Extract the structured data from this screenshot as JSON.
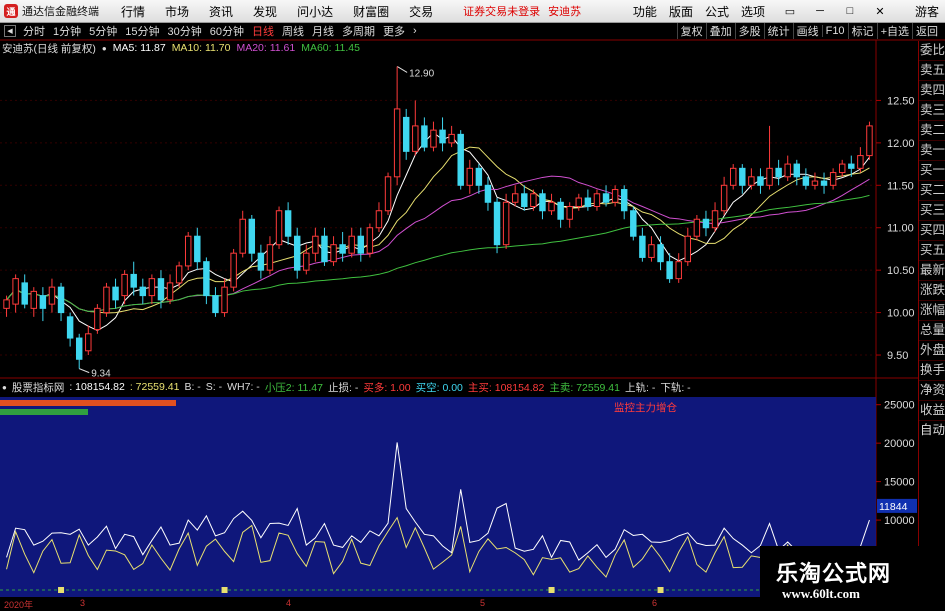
{
  "menubar": {
    "app_name": "通达信金融终端",
    "items": [
      "行情",
      "市场",
      "资讯",
      "发现",
      "问小达",
      "财富圈",
      "交易"
    ],
    "alert": "证券交易未登录",
    "stock": "安迪苏",
    "right_items": [
      "功能",
      "版面",
      "公式",
      "选项"
    ],
    "guest": "游客"
  },
  "toolbar": {
    "periods": [
      "分时",
      "1分钟",
      "5分钟",
      "15分钟",
      "30分钟",
      "60分钟",
      "日线",
      "周线",
      "月线",
      "多周期",
      "更多"
    ],
    "active_period": "日线",
    "right_items": [
      "复权",
      "叠加",
      "多股",
      "统计",
      "画线",
      "F10",
      "标记",
      "+自选",
      "返回"
    ]
  },
  "infobar": {
    "title": "安迪苏(日线 前复权)",
    "ma5": "MA5: 11.87",
    "ma10": "MA10: 11.70",
    "ma20": "MA20: 11.61",
    "ma60": "MA60: 11.45"
  },
  "price_axis": {
    "ticks": [
      "12.50",
      "12.00",
      "11.50",
      "11.00",
      "10.50",
      "10.00",
      "9.50"
    ]
  },
  "annotations": {
    "high": "12.90",
    "low": "9.34"
  },
  "indicator": {
    "name": "股票指标网",
    "v1": ": 108154.82",
    "v2": ": 72559.41",
    "b": "B: -",
    "s": "S: -",
    "wh7": "WH7: -",
    "xiaoya": "小压2: 11.47",
    "zhisun": "止损: -",
    "mairu": "买多: 1.00",
    "maikong": "买空: 0.00",
    "zhumai": "主买: 108154.82",
    "zhumai2": "主卖: 72559.41",
    "shanggui": "上轨: -",
    "xiagui": "下轨: -",
    "monitor": "监控主力增仓",
    "axis": [
      "25000",
      "20000",
      "15000",
      "10000"
    ],
    "current": "11844"
  },
  "sidebar": {
    "items": [
      "委比",
      "卖五",
      "卖四",
      "卖三",
      "卖二",
      "卖一",
      "买一",
      "买二",
      "买三",
      "买四",
      "买五",
      "最新",
      "涨跌",
      "涨幅",
      "总量",
      "外盘",
      "换手",
      "净资",
      "收益"
    ],
    "auto": "自动"
  },
  "date_axis": {
    "labels": [
      "2020年",
      "3",
      "4",
      "5",
      "6"
    ]
  },
  "watermark": {
    "title": "乐淘公式网",
    "url": "www.60lt.com"
  },
  "colors": {
    "up": "#ff3b3b",
    "down": "#3fd7f0",
    "ma5": "#ffffff",
    "ma10": "#e8e070",
    "ma20": "#d050d0",
    "ma60": "#40c040",
    "band": "#1a1a8a"
  },
  "chart_data": {
    "type": "candlestick",
    "candles": [
      [
        10.05,
        10.15,
        9.95,
        10.2
      ],
      [
        10.1,
        10.4,
        10.0,
        10.45
      ],
      [
        10.35,
        10.1,
        10.05,
        10.45
      ],
      [
        10.05,
        10.25,
        9.95,
        10.3
      ],
      [
        10.2,
        10.05,
        9.9,
        10.3
      ],
      [
        10.1,
        10.3,
        10.0,
        10.4
      ],
      [
        10.3,
        10.0,
        9.9,
        10.35
      ],
      [
        9.95,
        9.7,
        9.6,
        10.0
      ],
      [
        9.7,
        9.45,
        9.34,
        9.75
      ],
      [
        9.55,
        9.75,
        9.5,
        9.85
      ],
      [
        9.8,
        10.05,
        9.75,
        10.1
      ],
      [
        10.0,
        10.3,
        9.95,
        10.35
      ],
      [
        10.3,
        10.15,
        10.05,
        10.4
      ],
      [
        10.2,
        10.45,
        10.1,
        10.5
      ],
      [
        10.45,
        10.3,
        10.2,
        10.6
      ],
      [
        10.3,
        10.2,
        10.1,
        10.4
      ],
      [
        10.2,
        10.4,
        10.1,
        10.45
      ],
      [
        10.4,
        10.15,
        10.05,
        10.5
      ],
      [
        10.15,
        10.35,
        10.1,
        10.45
      ],
      [
        10.35,
        10.55,
        10.3,
        10.6
      ],
      [
        10.55,
        10.9,
        10.5,
        10.95
      ],
      [
        10.9,
        10.6,
        10.5,
        11.0
      ],
      [
        10.6,
        10.2,
        10.1,
        10.65
      ],
      [
        10.2,
        10.0,
        9.95,
        10.3
      ],
      [
        10.0,
        10.3,
        9.95,
        10.4
      ],
      [
        10.3,
        10.7,
        10.25,
        10.75
      ],
      [
        10.7,
        11.1,
        10.65,
        11.2
      ],
      [
        11.1,
        10.7,
        10.6,
        11.15
      ],
      [
        10.7,
        10.5,
        10.4,
        10.8
      ],
      [
        10.5,
        10.8,
        10.45,
        10.9
      ],
      [
        10.8,
        11.2,
        10.75,
        11.25
      ],
      [
        11.2,
        10.9,
        10.8,
        11.3
      ],
      [
        10.9,
        10.5,
        10.4,
        11.0
      ],
      [
        10.5,
        10.7,
        10.45,
        10.8
      ],
      [
        10.7,
        10.9,
        10.6,
        11.0
      ],
      [
        10.9,
        10.6,
        10.55,
        11.0
      ],
      [
        10.6,
        10.8,
        10.55,
        10.9
      ],
      [
        10.8,
        10.7,
        10.6,
        10.95
      ],
      [
        10.7,
        10.9,
        10.65,
        11.0
      ],
      [
        10.9,
        10.7,
        10.6,
        11.0
      ],
      [
        10.7,
        11.0,
        10.65,
        11.05
      ],
      [
        11.0,
        11.2,
        10.95,
        11.3
      ],
      [
        11.2,
        11.6,
        11.15,
        11.65
      ],
      [
        11.6,
        12.4,
        11.5,
        12.9
      ],
      [
        12.3,
        11.9,
        11.8,
        12.4
      ],
      [
        11.9,
        12.2,
        11.85,
        12.5
      ],
      [
        12.2,
        11.95,
        11.9,
        12.3
      ],
      [
        11.95,
        12.15,
        11.9,
        12.25
      ],
      [
        12.15,
        12.0,
        11.9,
        12.3
      ],
      [
        12.0,
        12.1,
        11.95,
        12.2
      ],
      [
        12.1,
        11.5,
        11.45,
        12.15
      ],
      [
        11.5,
        11.7,
        11.4,
        11.8
      ],
      [
        11.7,
        11.5,
        11.4,
        11.75
      ],
      [
        11.5,
        11.3,
        11.2,
        11.6
      ],
      [
        11.3,
        10.8,
        10.7,
        11.35
      ],
      [
        10.8,
        11.3,
        10.75,
        11.4
      ],
      [
        11.3,
        11.4,
        11.25,
        11.5
      ],
      [
        11.4,
        11.25,
        11.2,
        11.5
      ],
      [
        11.25,
        11.4,
        11.2,
        11.45
      ],
      [
        11.4,
        11.2,
        11.1,
        11.45
      ],
      [
        11.2,
        11.3,
        11.15,
        11.4
      ],
      [
        11.3,
        11.1,
        11.0,
        11.35
      ],
      [
        11.1,
        11.25,
        11.0,
        11.3
      ],
      [
        11.25,
        11.35,
        11.2,
        11.4
      ],
      [
        11.35,
        11.25,
        11.2,
        11.45
      ],
      [
        11.25,
        11.4,
        11.2,
        11.45
      ],
      [
        11.4,
        11.3,
        11.25,
        11.5
      ],
      [
        11.3,
        11.45,
        11.25,
        11.5
      ],
      [
        11.45,
        11.2,
        11.1,
        11.5
      ],
      [
        11.2,
        10.9,
        10.85,
        11.25
      ],
      [
        10.9,
        10.65,
        10.6,
        11.0
      ],
      [
        10.65,
        10.8,
        10.6,
        10.9
      ],
      [
        10.8,
        10.6,
        10.5,
        10.9
      ],
      [
        10.6,
        10.4,
        10.35,
        10.7
      ],
      [
        10.4,
        10.6,
        10.35,
        10.7
      ],
      [
        10.6,
        10.9,
        10.55,
        11.0
      ],
      [
        10.9,
        11.1,
        10.85,
        11.15
      ],
      [
        11.1,
        11.0,
        10.9,
        11.2
      ],
      [
        11.0,
        11.2,
        10.95,
        11.3
      ],
      [
        11.2,
        11.5,
        11.15,
        11.6
      ],
      [
        11.5,
        11.7,
        11.45,
        11.75
      ],
      [
        11.7,
        11.5,
        11.4,
        11.75
      ],
      [
        11.5,
        11.6,
        11.45,
        11.7
      ],
      [
        11.6,
        11.5,
        11.4,
        11.7
      ],
      [
        11.5,
        11.7,
        11.45,
        12.2
      ],
      [
        11.7,
        11.6,
        11.5,
        11.8
      ],
      [
        11.6,
        11.75,
        11.55,
        11.85
      ],
      [
        11.75,
        11.6,
        11.5,
        11.8
      ],
      [
        11.6,
        11.5,
        11.45,
        11.7
      ],
      [
        11.5,
        11.55,
        11.45,
        11.65
      ],
      [
        11.55,
        11.5,
        11.4,
        11.65
      ],
      [
        11.5,
        11.65,
        11.45,
        11.7
      ],
      [
        11.65,
        11.75,
        11.6,
        11.8
      ],
      [
        11.75,
        11.7,
        11.6,
        11.85
      ],
      [
        11.7,
        11.85,
        11.65,
        11.95
      ],
      [
        11.85,
        12.2,
        11.8,
        12.25
      ]
    ],
    "y_range": [
      9.3,
      13.0
    ]
  }
}
